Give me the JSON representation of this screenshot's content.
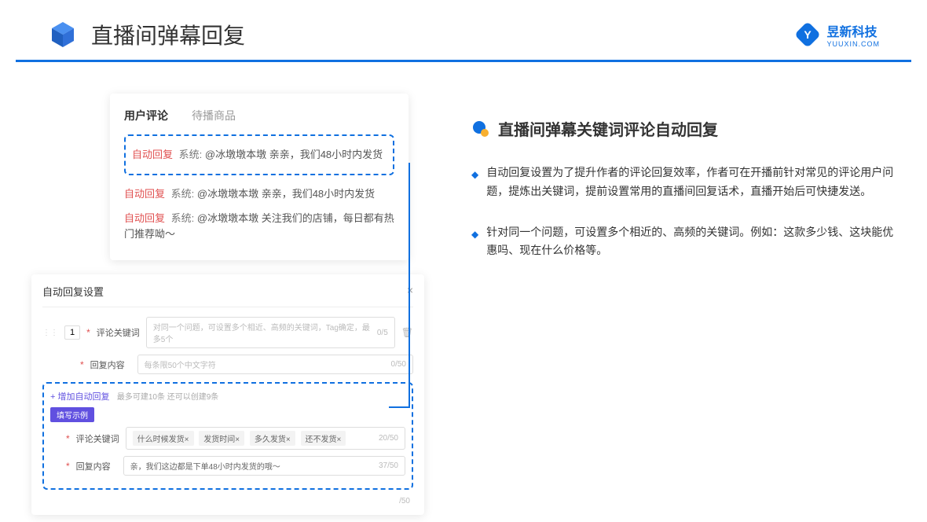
{
  "header": {
    "title": "直播间弹幕回复",
    "brand_name": "昱新科技",
    "brand_sub": "YUUXIN.COM"
  },
  "card1": {
    "tab_active": "用户评论",
    "tab_inactive": "待播商品",
    "auto_label": "自动回复",
    "sys_label": "系统:",
    "line1": "@冰墩墩本墩 亲亲，我们48小时内发货",
    "line2": "@冰墩墩本墩 亲亲，我们48小时内发货",
    "line3": "@冰墩墩本墩 关注我们的店铺，每日都有热门推荐呦～"
  },
  "card2": {
    "title": "自动回复设置",
    "num": "1",
    "label_keyword": "评论关键词",
    "placeholder_keyword": "对同一个问题，可设置多个相近、高频的关键词，Tag确定，最多5个",
    "count_keyword": "0/5",
    "label_content": "回复内容",
    "placeholder_content": "每条限50个中文字符",
    "count_content": "0/50",
    "add_link": "+ 增加自动回复",
    "add_hint": "最多可建10条 还可以创建9条",
    "example_badge": "填写示例",
    "ex_label_keyword": "评论关键词",
    "tag1": "什么时候发货×",
    "tag2": "发货时间×",
    "tag3": "多久发货×",
    "tag4": "还不发货×",
    "ex_count_keyword": "20/50",
    "ex_label_content": "回复内容",
    "ex_content": "亲，我们这边都是下单48小时内发货的哦～",
    "ex_count_content": "37/50",
    "extra_count": "/50"
  },
  "right": {
    "section_title": "直播间弹幕关键词评论自动回复",
    "bullet1": "自动回复设置为了提升作者的评论回复效率，作者可在开播前针对常见的评论用户问题，提炼出关键词，提前设置常用的直播间回复话术，直播开始后可快捷发送。",
    "bullet2": "针对同一个问题，可设置多个相近的、高频的关键词。例如：这款多少钱、这块能优惠吗、现在什么价格等。"
  }
}
